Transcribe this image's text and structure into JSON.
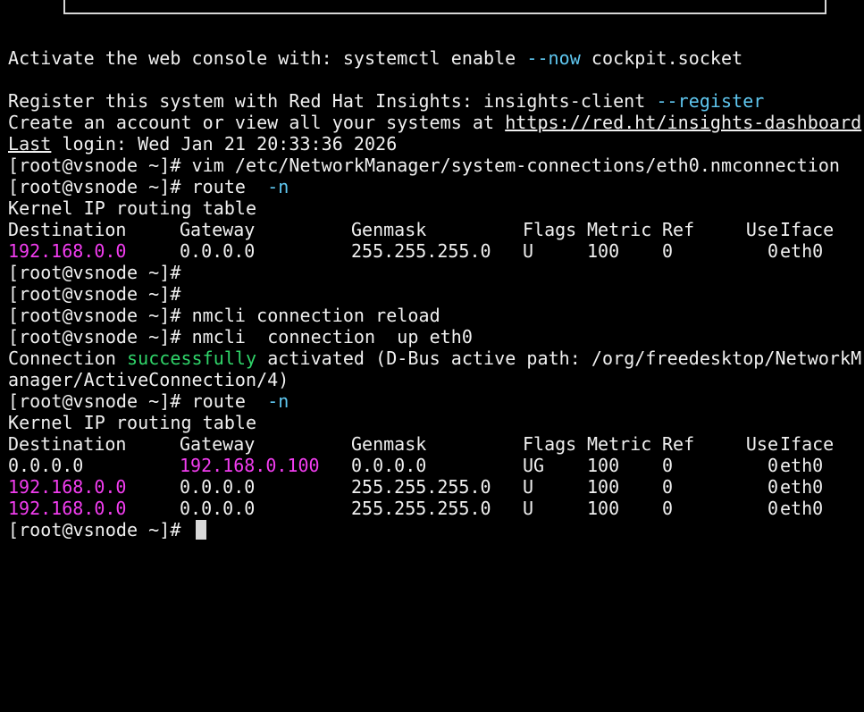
{
  "terminal": {
    "activate": {
      "prefix": "Activate the web console with: systemctl enable ",
      "flag": "--now",
      "suffix": " cockpit.socket"
    },
    "register": {
      "prefix": "Register this system with Red Hat Insights: insights-client ",
      "flag": "--register"
    },
    "account": {
      "prefix": "Create an account or view all your systems at ",
      "link": "https://red.ht/insights-dashboard"
    },
    "last_login": {
      "word": "Last",
      "rest": " login: Wed Jan 21 20:33:36 2026"
    },
    "prompt": "[root@vsnode ~]# ",
    "cmd_vim": "vim /etc/NetworkManager/system-connections/eth0.nmconnection",
    "cmd_route_1": "route  ",
    "cmd_route_flag": "-n",
    "routing_title": "Kernel IP routing table",
    "headers": {
      "destination": "Destination",
      "gateway": "Gateway",
      "genmask": "Genmask",
      "flags": "Flags",
      "metric": "Metric",
      "ref": "Ref",
      "use": "Use",
      "iface": "Iface"
    },
    "table1": [
      {
        "destination": "192.168.0.0",
        "gateway": "0.0.0.0",
        "genmask": "255.255.255.0",
        "flags": "U",
        "metric": "100",
        "ref": "0",
        "use": "0",
        "iface": "eth0"
      }
    ],
    "cmd_reload": "nmcli connection reload",
    "cmd_up": "nmcli  connection  up eth0",
    "connection": {
      "prefix": "Connection ",
      "success": "successfully",
      "suffix": " activated (D-Bus active path: /org/freedesktop/NetworkM",
      "wrap": "anager/ActiveConnection/4)"
    },
    "table2": [
      {
        "destination": "0.0.0.0",
        "gateway": "192.168.0.100",
        "genmask": "0.0.0.0",
        "flags": "UG",
        "metric": "100",
        "ref": "0",
        "use": "0",
        "iface": "eth0"
      },
      {
        "destination": "192.168.0.0",
        "gateway": "0.0.0.0",
        "genmask": "255.255.255.0",
        "flags": "U",
        "metric": "100",
        "ref": "0",
        "use": "0",
        "iface": "eth0"
      },
      {
        "destination": "192.168.0.0",
        "gateway": "0.0.0.0",
        "genmask": "255.255.255.0",
        "flags": "U",
        "metric": "100",
        "ref": "0",
        "use": "0",
        "iface": "eth0"
      }
    ],
    "colors": {
      "background": "#000000",
      "text": "#f0f0f0",
      "flag_cyan": "#5fc7f0",
      "ip_magenta": "#f23df0",
      "success_green": "#30d56a"
    }
  }
}
